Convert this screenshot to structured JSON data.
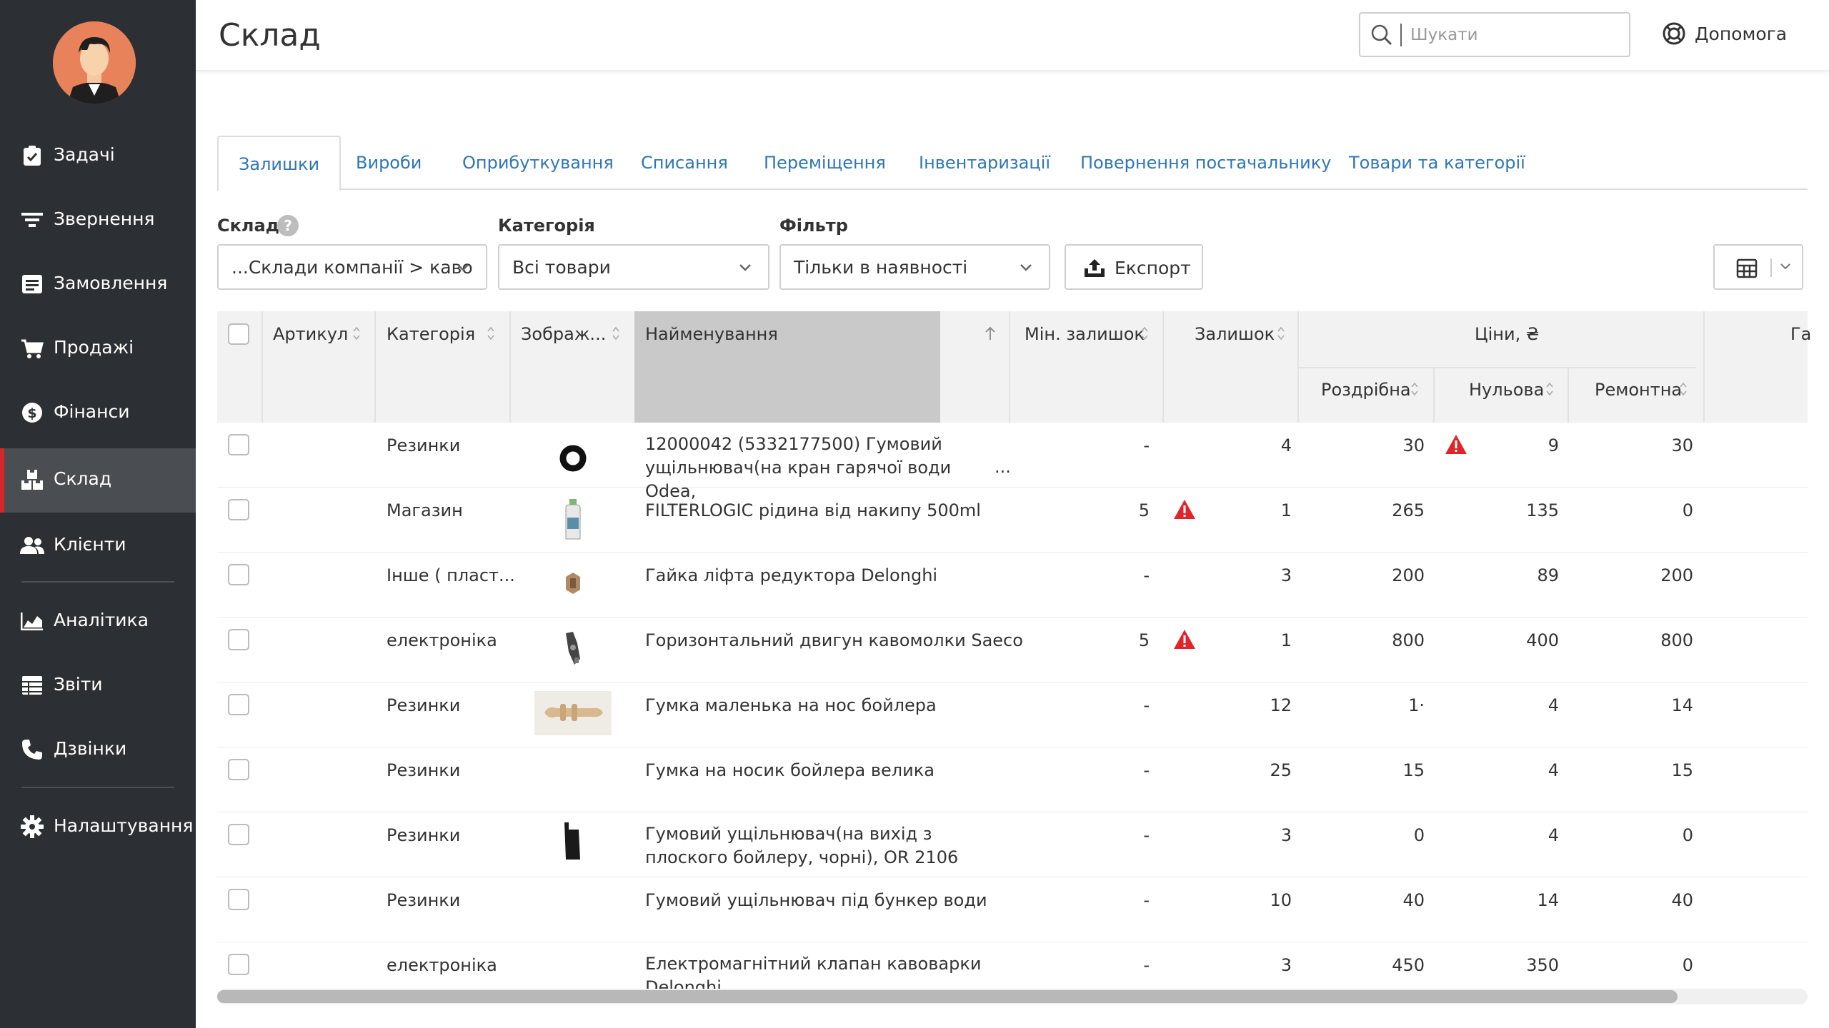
{
  "app": {
    "title": "Склад"
  },
  "search": {
    "placeholder": "Шукати"
  },
  "help": {
    "label": "Допомога"
  },
  "sidebar": {
    "items": [
      {
        "label": "Задачі",
        "icon": "clipboard-check-icon"
      },
      {
        "label": "Звернення",
        "icon": "filter-lines-icon"
      },
      {
        "label": "Замовлення",
        "icon": "order-list-icon"
      },
      {
        "label": "Продажі",
        "icon": "cart-icon"
      },
      {
        "label": "Фінанси",
        "icon": "dollar-circle-icon"
      },
      {
        "label": "Склад",
        "icon": "boxes-icon",
        "active": true
      },
      {
        "label": "Клієнти",
        "icon": "users-icon"
      },
      {
        "label": "Аналітика",
        "icon": "area-chart-icon"
      },
      {
        "label": "Звіти",
        "icon": "table-list-icon"
      },
      {
        "label": "Дзвінки",
        "icon": "phone-icon"
      },
      {
        "label": "Налаштування",
        "icon": "gear-icon"
      }
    ]
  },
  "tabs": [
    "Залишки",
    "Вироби",
    "Оприбуткування",
    "Списання",
    "Переміщення",
    "Інвентаризації",
    "Повернення постачальнику",
    "Товари та категорії"
  ],
  "filters": {
    "warehouse_label": "Склад",
    "warehouse_value": "...Склади компанії > каво",
    "category_label": "Категорія",
    "category_value": "Всі товари",
    "filter_label": "Фільтр",
    "filter_value": "Тільки в наявності",
    "export_label": "Експорт",
    "help_mark": "?"
  },
  "table": {
    "headers": {
      "article": "Артикул",
      "category": "Категорія",
      "image": "Зображ...",
      "name": "Найменування",
      "min_stock": "Мін. залишок",
      "stock": "Залишок",
      "prices": "Ціни, ₴",
      "retail": "Роздрібна",
      "zero": "Нульова",
      "repair": "Ремонтна",
      "extra": "Га"
    },
    "rows": [
      {
        "category": "Резинки",
        "name": "12000042 (5332177500) Гумовий ущільнювач(на кран гарячої води Odea,",
        "name_ellipsis": "...",
        "min": "-",
        "stock": "4",
        "retail": "30",
        "zero": "9",
        "repair": "30",
        "min_warn": false,
        "zero_warn": true,
        "thumb": "o-ring"
      },
      {
        "category": "Магазин",
        "name": "FILTERLOGIC рідина від накипу 500ml",
        "name_ellipsis": "",
        "min": "5",
        "stock": "1",
        "retail": "265",
        "zero": "135",
        "repair": "0",
        "min_warn": true,
        "zero_warn": false,
        "thumb": "bottle"
      },
      {
        "category": "Інше ( пласт...",
        "name": "Гайка ліфта редуктора Delonghi",
        "name_ellipsis": "",
        "min": "-",
        "stock": "3",
        "retail": "200",
        "zero": "89",
        "repair": "200",
        "min_warn": false,
        "zero_warn": false,
        "thumb": "nut"
      },
      {
        "category": "електроніка",
        "name": "Горизонтальний двигун кавомолки Saeco",
        "name_ellipsis": "",
        "min": "5",
        "stock": "1",
        "retail": "800",
        "zero": "400",
        "repair": "800",
        "min_warn": true,
        "zero_warn": false,
        "thumb": "motor"
      },
      {
        "category": "Резинки",
        "name": "Гумка маленька на нос бойлера",
        "name_ellipsis": "",
        "min": "-",
        "stock": "12",
        "retail": "1·",
        "zero": "4",
        "repair": "14",
        "min_warn": false,
        "zero_warn": false,
        "thumb": "rubber"
      },
      {
        "category": "Резинки",
        "name": "Гумка на носик бойлера велика",
        "name_ellipsis": "",
        "min": "-",
        "stock": "25",
        "retail": "15",
        "zero": "4",
        "repair": "15",
        "min_warn": false,
        "zero_warn": false,
        "thumb": "none"
      },
      {
        "category": "Резинки",
        "name": "Гумовий ущільнювач(на вихід з плоского бойлеру, чорні), OR 2106",
        "name_ellipsis": "",
        "min": "-",
        "stock": "3",
        "retail": "0",
        "zero": "4",
        "repair": "0",
        "min_warn": false,
        "zero_warn": false,
        "thumb": "black-seal"
      },
      {
        "category": "Резинки",
        "name": "Гумовий ущільнювач під бункер води",
        "name_ellipsis": "",
        "min": "-",
        "stock": "10",
        "retail": "40",
        "zero": "14",
        "repair": "40",
        "min_warn": false,
        "zero_warn": false,
        "thumb": "none"
      },
      {
        "category": "електроніка",
        "name": "Електромагнітний клапан кавоварки Delonghi",
        "name_ellipsis": "",
        "min": "-",
        "stock": "3",
        "retail": "450",
        "zero": "350",
        "repair": "0",
        "min_warn": false,
        "zero_warn": false,
        "thumb": "none"
      }
    ]
  },
  "colors": {
    "sidebar": "#2c2f33",
    "active_marker": "#d9262b",
    "link": "#2f76b6",
    "warning": "#e0242b"
  }
}
